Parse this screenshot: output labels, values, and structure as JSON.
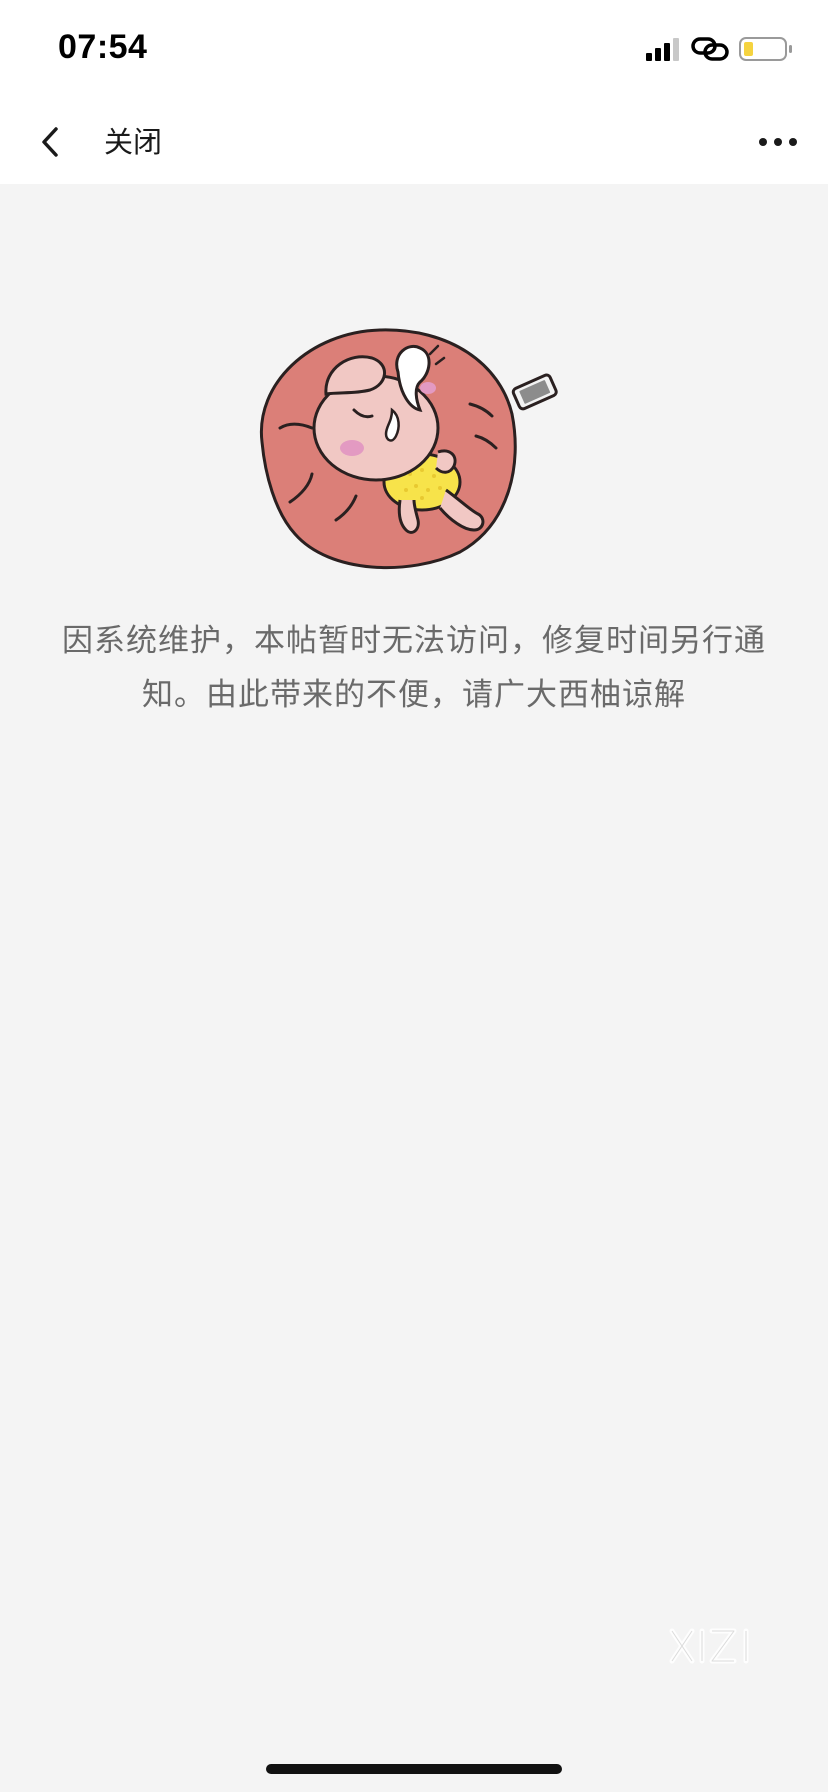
{
  "status_bar": {
    "time": "07:54",
    "icons": [
      "signal-icon",
      "link-icon",
      "battery-icon"
    ]
  },
  "nav": {
    "back_icon": "chevron-left-icon",
    "close_label": "关闭",
    "more_icon": "more-dots-icon"
  },
  "main": {
    "illustration": "sleeping-character-illustration",
    "message": "因系统维护，本帖暂时无法访问，修复时间另行通知。由此带来的不便，请广大西柚谅解"
  },
  "watermark": {
    "text": "XIZI"
  },
  "colors": {
    "page_bg": "#f4f4f4",
    "bar_bg": "#ffffff",
    "message_text": "#6a6a6a",
    "cushion": "#db7f78",
    "battery_fill": "#f5d33f"
  }
}
